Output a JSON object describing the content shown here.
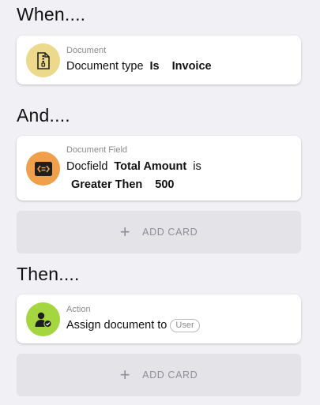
{
  "sections": {
    "when": {
      "title": "When...."
    },
    "and": {
      "title": "And...."
    },
    "then": {
      "title": "Then...."
    }
  },
  "cards": {
    "document": {
      "label": "Document",
      "prefix": "Document type",
      "operator": "Is",
      "value": "Invoice",
      "icon": "zip-document-icon",
      "icon_bg": "#ecd98c"
    },
    "docfield": {
      "label": "Document Field",
      "prefix": "Docfield",
      "field": "Total Amount",
      "verb": "is",
      "operator": "Greater Then",
      "value": "500",
      "icon": "code-brackets-icon",
      "icon_bg": "#f0a04b"
    },
    "action": {
      "label": "Action",
      "text": "Assign document to",
      "chip": "User",
      "icon": "user-check-icon",
      "icon_bg": "#a6d63f"
    }
  },
  "add_card": {
    "label": "ADD CARD"
  }
}
